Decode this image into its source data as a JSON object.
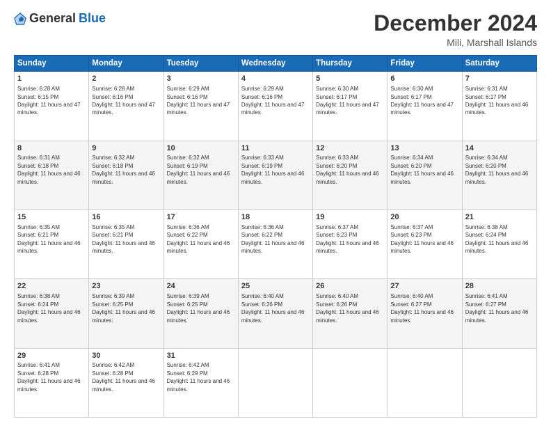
{
  "logo": {
    "general": "General",
    "blue": "Blue"
  },
  "header": {
    "month": "December 2024",
    "location": "Mili, Marshall Islands"
  },
  "days": [
    "Sunday",
    "Monday",
    "Tuesday",
    "Wednesday",
    "Thursday",
    "Friday",
    "Saturday"
  ],
  "weeks": [
    [
      {
        "day": 1,
        "sunrise": "6:28 AM",
        "sunset": "6:15 PM",
        "daylight": "11 hours and 47 minutes."
      },
      {
        "day": 2,
        "sunrise": "6:28 AM",
        "sunset": "6:16 PM",
        "daylight": "11 hours and 47 minutes."
      },
      {
        "day": 3,
        "sunrise": "6:29 AM",
        "sunset": "6:16 PM",
        "daylight": "11 hours and 47 minutes."
      },
      {
        "day": 4,
        "sunrise": "6:29 AM",
        "sunset": "6:16 PM",
        "daylight": "11 hours and 47 minutes."
      },
      {
        "day": 5,
        "sunrise": "6:30 AM",
        "sunset": "6:17 PM",
        "daylight": "11 hours and 47 minutes."
      },
      {
        "day": 6,
        "sunrise": "6:30 AM",
        "sunset": "6:17 PM",
        "daylight": "11 hours and 47 minutes."
      },
      {
        "day": 7,
        "sunrise": "6:31 AM",
        "sunset": "6:17 PM",
        "daylight": "11 hours and 46 minutes."
      }
    ],
    [
      {
        "day": 8,
        "sunrise": "6:31 AM",
        "sunset": "6:18 PM",
        "daylight": "11 hours and 46 minutes."
      },
      {
        "day": 9,
        "sunrise": "6:32 AM",
        "sunset": "6:18 PM",
        "daylight": "11 hours and 46 minutes."
      },
      {
        "day": 10,
        "sunrise": "6:32 AM",
        "sunset": "6:19 PM",
        "daylight": "11 hours and 46 minutes."
      },
      {
        "day": 11,
        "sunrise": "6:33 AM",
        "sunset": "6:19 PM",
        "daylight": "11 hours and 46 minutes."
      },
      {
        "day": 12,
        "sunrise": "6:33 AM",
        "sunset": "6:20 PM",
        "daylight": "11 hours and 46 minutes."
      },
      {
        "day": 13,
        "sunrise": "6:34 AM",
        "sunset": "6:20 PM",
        "daylight": "11 hours and 46 minutes."
      },
      {
        "day": 14,
        "sunrise": "6:34 AM",
        "sunset": "6:20 PM",
        "daylight": "11 hours and 46 minutes."
      }
    ],
    [
      {
        "day": 15,
        "sunrise": "6:35 AM",
        "sunset": "6:21 PM",
        "daylight": "11 hours and 46 minutes."
      },
      {
        "day": 16,
        "sunrise": "6:35 AM",
        "sunset": "6:21 PM",
        "daylight": "11 hours and 46 minutes."
      },
      {
        "day": 17,
        "sunrise": "6:36 AM",
        "sunset": "6:22 PM",
        "daylight": "11 hours and 46 minutes."
      },
      {
        "day": 18,
        "sunrise": "6:36 AM",
        "sunset": "6:22 PM",
        "daylight": "11 hours and 46 minutes."
      },
      {
        "day": 19,
        "sunrise": "6:37 AM",
        "sunset": "6:23 PM",
        "daylight": "11 hours and 46 minutes."
      },
      {
        "day": 20,
        "sunrise": "6:37 AM",
        "sunset": "6:23 PM",
        "daylight": "11 hours and 46 minutes."
      },
      {
        "day": 21,
        "sunrise": "6:38 AM",
        "sunset": "6:24 PM",
        "daylight": "11 hours and 46 minutes."
      }
    ],
    [
      {
        "day": 22,
        "sunrise": "6:38 AM",
        "sunset": "6:24 PM",
        "daylight": "11 hours and 46 minutes."
      },
      {
        "day": 23,
        "sunrise": "6:39 AM",
        "sunset": "6:25 PM",
        "daylight": "11 hours and 46 minutes."
      },
      {
        "day": 24,
        "sunrise": "6:39 AM",
        "sunset": "6:25 PM",
        "daylight": "11 hours and 46 minutes."
      },
      {
        "day": 25,
        "sunrise": "6:40 AM",
        "sunset": "6:26 PM",
        "daylight": "11 hours and 46 minutes."
      },
      {
        "day": 26,
        "sunrise": "6:40 AM",
        "sunset": "6:26 PM",
        "daylight": "11 hours and 46 minutes."
      },
      {
        "day": 27,
        "sunrise": "6:40 AM",
        "sunset": "6:27 PM",
        "daylight": "11 hours and 46 minutes."
      },
      {
        "day": 28,
        "sunrise": "6:41 AM",
        "sunset": "6:27 PM",
        "daylight": "11 hours and 46 minutes."
      }
    ],
    [
      {
        "day": 29,
        "sunrise": "6:41 AM",
        "sunset": "6:28 PM",
        "daylight": "11 hours and 46 minutes."
      },
      {
        "day": 30,
        "sunrise": "6:42 AM",
        "sunset": "6:28 PM",
        "daylight": "11 hours and 46 minutes."
      },
      {
        "day": 31,
        "sunrise": "6:42 AM",
        "sunset": "6:29 PM",
        "daylight": "11 hours and 46 minutes."
      },
      null,
      null,
      null,
      null
    ]
  ]
}
